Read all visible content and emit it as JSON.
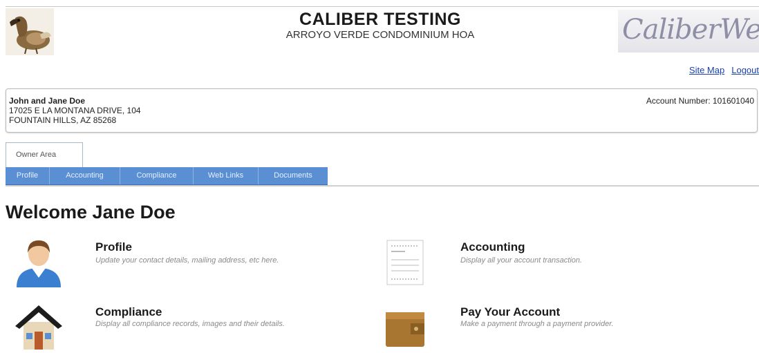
{
  "header": {
    "title": "CALIBER TESTING",
    "subtitle": "ARROYO VERDE CONDOMINIUM HOA",
    "logo_text": "CaliberWeb"
  },
  "top_links": {
    "site_map": "Site Map",
    "logout": "Logout"
  },
  "owner": {
    "name": "John and Jane Doe",
    "address_line1": "17025 E LA MONTANA DRIVE, 104",
    "address_line2": "FOUNTAIN HILLS, AZ 85268",
    "account_number": "Account Number: 101601040"
  },
  "tabs": [
    {
      "label": "Owner Area"
    }
  ],
  "nav": [
    {
      "label": "Profile"
    },
    {
      "label": "Accounting"
    },
    {
      "label": "Compliance"
    },
    {
      "label": "Web Links"
    },
    {
      "label": "Documents"
    }
  ],
  "welcome": "Welcome Jane Doe",
  "tiles": [
    {
      "title": "Profile",
      "desc": "Update your contact details, mailing address, etc here.",
      "icon": "person-icon"
    },
    {
      "title": "Accounting",
      "desc": "Display all your account transaction.",
      "icon": "ledger-icon"
    },
    {
      "title": "Compliance",
      "desc": "Display all compliance records, images and their details.",
      "icon": "house-icon"
    },
    {
      "title": "Pay Your Account",
      "desc": "Make a payment through a payment provider.",
      "icon": "wallet-icon"
    }
  ],
  "colors": {
    "nav_bar": "#5a8fd4",
    "link": "#1a3fb0"
  }
}
